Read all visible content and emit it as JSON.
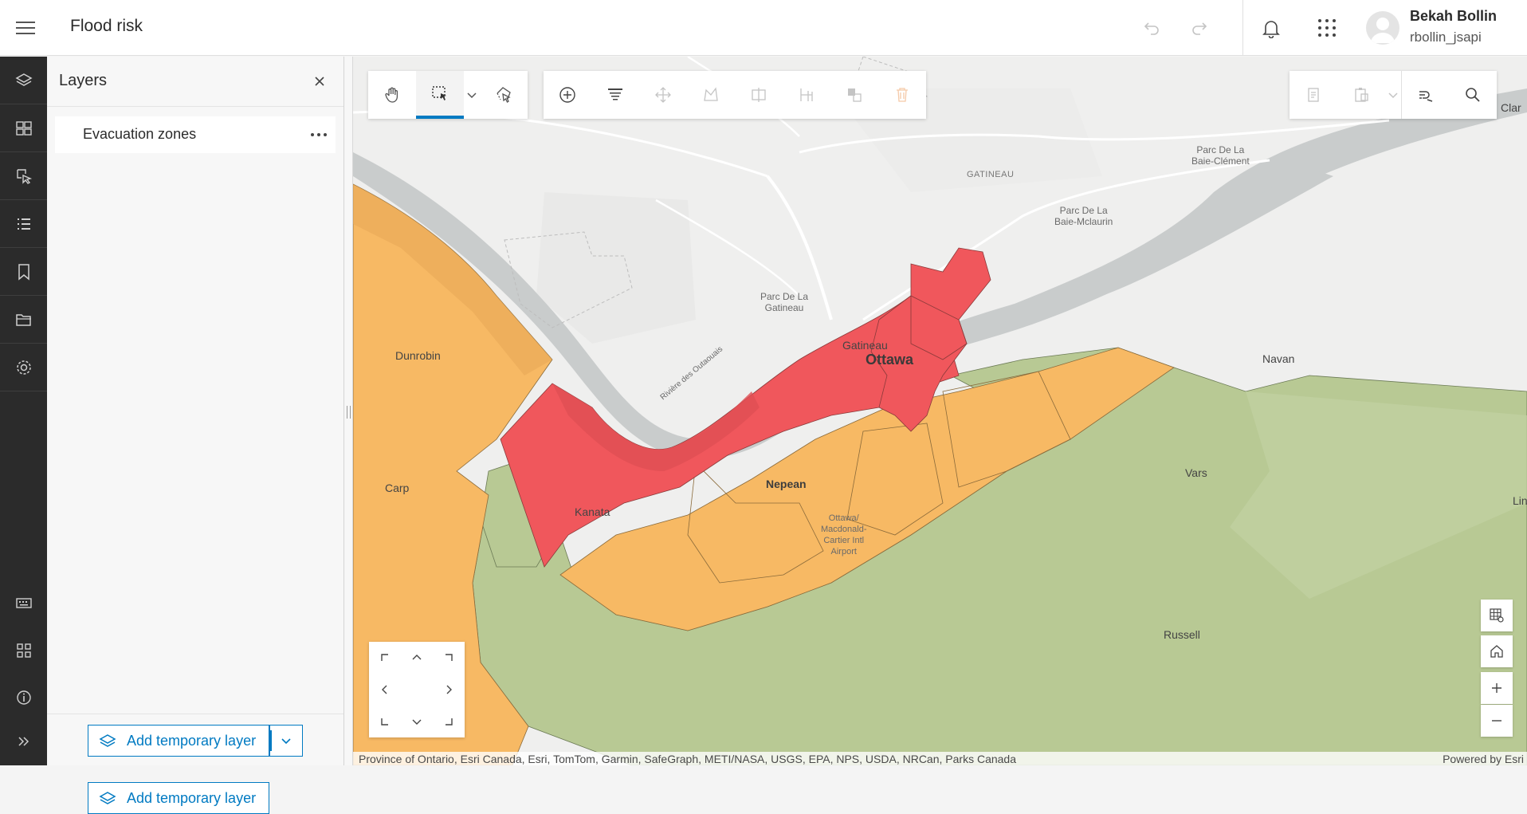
{
  "header": {
    "app_title": "Flood risk",
    "user_name": "Bekah Bollin",
    "user_id": "rbollin_jsapi",
    "icons": [
      "menu-icon",
      "undo-icon",
      "redo-icon",
      "bell-icon",
      "apps-grid-icon",
      "avatar"
    ]
  },
  "rail": {
    "items": [
      "layers-icon",
      "basemap-icon",
      "select-features-icon",
      "list-icon",
      "bookmark-icon",
      "folder-icon",
      "settings-icon",
      "keyboard-icon",
      "widgets-grid-icon",
      "info-icon",
      "expand-icon"
    ]
  },
  "layers_panel": {
    "title": "Layers",
    "layers": [
      {
        "name": "Evacuation zones"
      }
    ],
    "add_button_label": "Add temporary layer"
  },
  "toolbars": {
    "left": [
      "pan-tool",
      "rectangle-select-tool",
      "select-dropdown",
      "lasso-select-tool"
    ],
    "editing": [
      "add-feature",
      "attributes",
      "move",
      "reshape",
      "split",
      "merge",
      "replace",
      "delete"
    ],
    "right": [
      "copy",
      "paste",
      "paste-dropdown",
      "snapping",
      "search"
    ]
  },
  "map": {
    "labels": {
      "gatineau_region": "GATINEAU",
      "parc_baie_clement": "Parc De La\nBaie-Clément",
      "parc_baie_mclaurin": "Parc De La\nBaie-Mclaurin",
      "parc_gatineau": "Parc De La\nGatineau",
      "gatineau_city": "Gatineau",
      "ottawa": "Ottawa",
      "navan": "Navan",
      "dunrobin": "Dunrobin",
      "carp": "Carp",
      "kanata": "Kanata",
      "nepean": "Nepean",
      "airport": "Ottawa/\nMacdonald-\nCartier Intl\nAirport",
      "vars": "Vars",
      "russell": "Russell",
      "riviere": "Rivière des Outaouais",
      "clar": "Clar",
      "lin": "Lin"
    },
    "colors": {
      "high_risk": "#f0575c",
      "medium_risk": "#f7b964",
      "low_risk": "#b8c994",
      "water": "#c8cbcb"
    },
    "attribution": "Province of Ontario, Esri Canada, Esri, TomTom, Garmin, SafeGraph, METI/NASA, USGS, EPA, NPS, USDA, NRCan, Parks Canada",
    "powered_by": "Powered by Esri"
  }
}
